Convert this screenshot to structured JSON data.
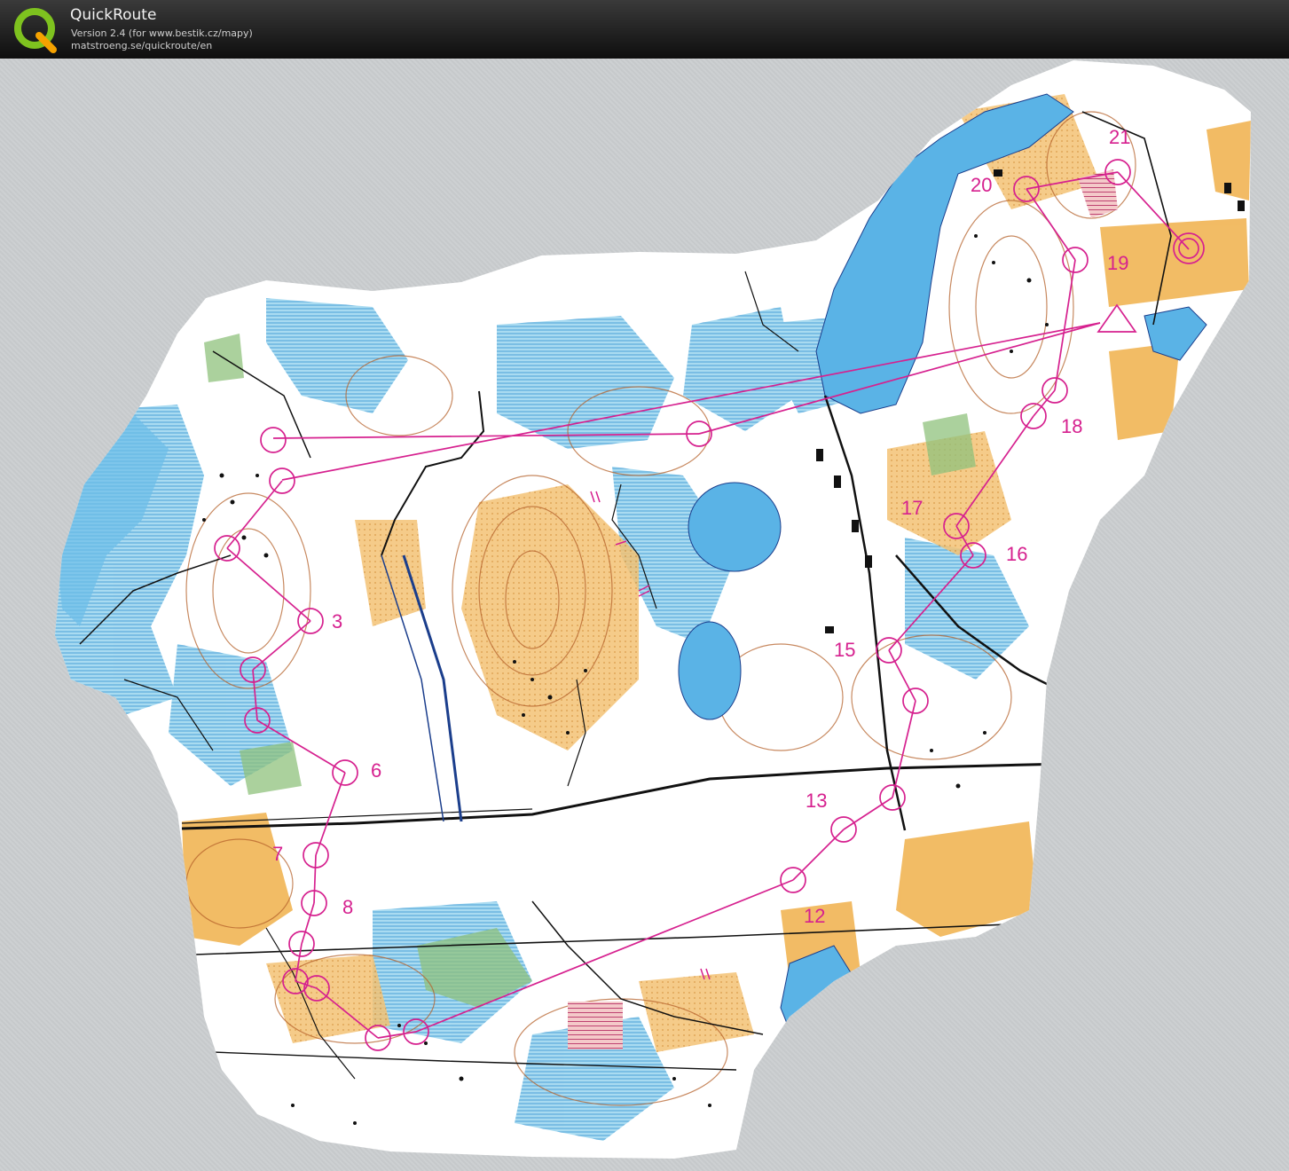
{
  "window": {
    "title": "QuickRoute",
    "version": "Version 2.4  (for www.bestik.cz/mapy)",
    "url": "matstroeng.se/quickroute/en"
  },
  "colors": {
    "course": "#d6218f",
    "water": "#5ab3e6",
    "marsh": "#7cc7e8",
    "open": "#f0b04a",
    "rough_open": "#f6d08a",
    "forest_green": "#9cc98a",
    "contour": "#b5622b",
    "background": "#c9ccce"
  },
  "icons": {
    "logo": "quickroute-q-logo"
  },
  "course": {
    "controls": [
      {
        "id": "start",
        "type": "start-triangle",
        "label": ""
      },
      {
        "id": "c1",
        "label": ""
      },
      {
        "id": "c2",
        "label": ""
      },
      {
        "id": "c3",
        "label": "3"
      },
      {
        "id": "c4",
        "label": ""
      },
      {
        "id": "c5",
        "label": ""
      },
      {
        "id": "c6",
        "label": "6"
      },
      {
        "id": "c7",
        "label": "7"
      },
      {
        "id": "c8",
        "label": "8"
      },
      {
        "id": "c9",
        "label": ""
      },
      {
        "id": "c10",
        "label": ""
      },
      {
        "id": "c11",
        "label": ""
      },
      {
        "id": "c12",
        "label": "12"
      },
      {
        "id": "c13",
        "label": "13"
      },
      {
        "id": "c14",
        "label": ""
      },
      {
        "id": "c15",
        "label": "15"
      },
      {
        "id": "c16",
        "label": "16"
      },
      {
        "id": "c17",
        "label": "17"
      },
      {
        "id": "c18",
        "label": "18"
      },
      {
        "id": "c19",
        "label": "19"
      },
      {
        "id": "c20",
        "label": "20"
      },
      {
        "id": "c21",
        "label": "21"
      },
      {
        "id": "finish",
        "type": "finish-double-circle",
        "label": ""
      }
    ]
  }
}
